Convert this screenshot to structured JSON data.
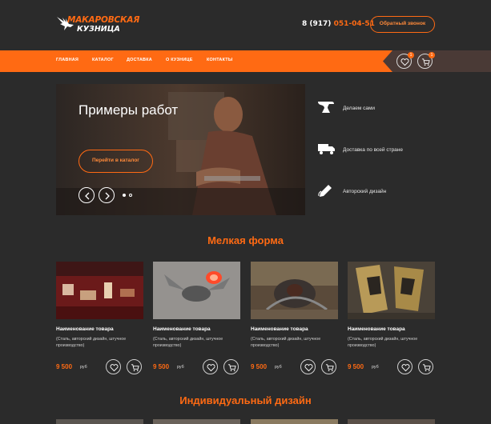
{
  "header": {
    "logo_line1": "МАКАРОВСКАЯ",
    "logo_line2": "КУЗНИЦА",
    "phone_prefix": "8 (917)",
    "phone_number": "051-04-51",
    "callback_label": "Обратный звонок"
  },
  "nav": {
    "items": [
      "ГЛАВНАЯ",
      "КАТАЛОГ",
      "ДОСТАВКА",
      "О КУЗНИЦЕ",
      "КОНТАКТЫ"
    ],
    "favorites_count": "1",
    "cart_count": "1"
  },
  "hero": {
    "title": "Примеры работ",
    "button_label": "Перейти в каталог",
    "active_slide": 1,
    "slide_count": 2
  },
  "features": [
    {
      "icon": "anvil-icon",
      "label": "Делаем сами"
    },
    {
      "icon": "truck-icon",
      "label": "Доставка по всей стране"
    },
    {
      "icon": "pen-icon",
      "label": "Авторский дизайн"
    }
  ],
  "sections": {
    "small_form_title": "Мелкая форма",
    "custom_design_title": "Индивидуальный дизайн"
  },
  "products": [
    {
      "name": "Наименование товара",
      "description": "(Сталь, авторский дизайн, штучное производство)",
      "price": "9 500",
      "currency": "руб"
    },
    {
      "name": "Наименование товара",
      "description": "(Сталь, авторский дизайн, штучное производство)",
      "price": "9 500",
      "currency": "руб"
    },
    {
      "name": "Наименование товара",
      "description": "(Сталь, авторский дизайн, штучное производство)",
      "price": "9 500",
      "currency": "руб"
    },
    {
      "name": "Наименование товара",
      "description": "(Сталь, авторский дизайн, штучное производство)",
      "price": "9 500",
      "currency": "руб"
    }
  ],
  "colors": {
    "accent": "#ff6a13",
    "background": "#2b2b2b"
  }
}
